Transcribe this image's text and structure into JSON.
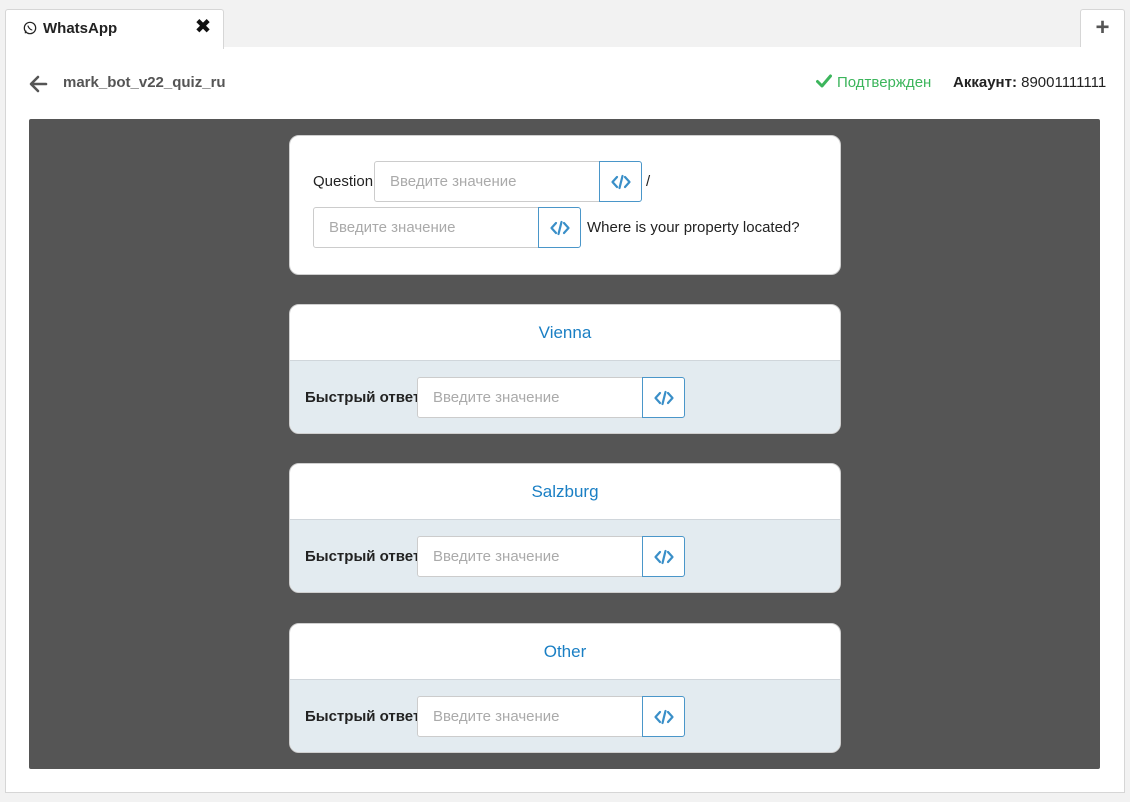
{
  "tab": {
    "title": "WhatsApp",
    "close_icon": "close-icon",
    "add_icon": "plus-icon"
  },
  "header": {
    "bot_name": "mark_bot_v22_quiz_ru",
    "status": "Подтвержден",
    "account_label": "Аккаунт:",
    "account_value": "89001111111"
  },
  "question": {
    "label": "Question",
    "input1_placeholder": "Введите значение",
    "separator": "/",
    "input2_placeholder": "Введите значение",
    "text": "Where is your property located?"
  },
  "answers": [
    {
      "title": "Vienna",
      "quick_label": "Быстрый ответ:",
      "placeholder": "Введите значение"
    },
    {
      "title": "Salzburg",
      "quick_label": "Быстрый ответ:",
      "placeholder": "Введите значение"
    },
    {
      "title": "Other",
      "quick_label": "Быстрый ответ:",
      "placeholder": "Введите значение"
    }
  ],
  "colors": {
    "accent": "#1a7fc4",
    "status_green": "#3cb55c",
    "canvas_bg": "#555555"
  }
}
